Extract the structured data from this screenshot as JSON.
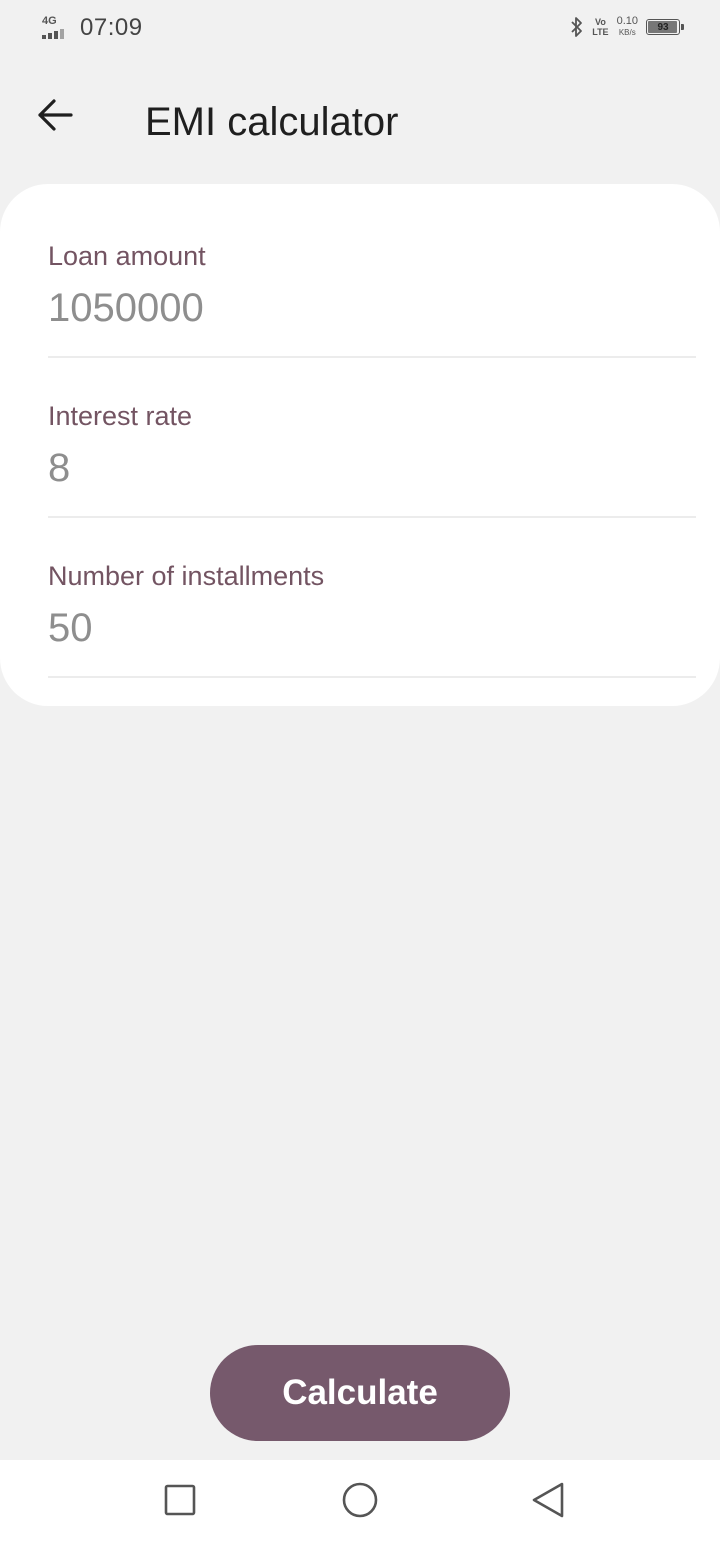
{
  "status_bar": {
    "network_type": "4G",
    "time": "07:09",
    "volte_top": "Vo",
    "volte_bottom": "LTE",
    "data_speed": "0.10",
    "data_speed_unit": "KB/s",
    "battery_level": "93",
    "icons": [
      "signal-icon",
      "bluetooth-icon",
      "volte-icon",
      "battery-icon"
    ]
  },
  "app_bar": {
    "title": "EMI calculator",
    "back_icon": "arrow-left-icon"
  },
  "form": {
    "fields": [
      {
        "label": "Loan amount",
        "value": "1050000"
      },
      {
        "label": "Interest rate",
        "value": "8"
      },
      {
        "label": "Number of installments",
        "value": "50"
      }
    ]
  },
  "actions": {
    "calculate_label": "Calculate"
  },
  "nav_bar": {
    "icons": [
      "recents-square-icon",
      "home-circle-icon",
      "back-triangle-icon"
    ]
  },
  "colors": {
    "background": "#f1f1f1",
    "card": "#ffffff",
    "label": "#735462",
    "value": "#8e8e8e",
    "button": "#76596c"
  }
}
